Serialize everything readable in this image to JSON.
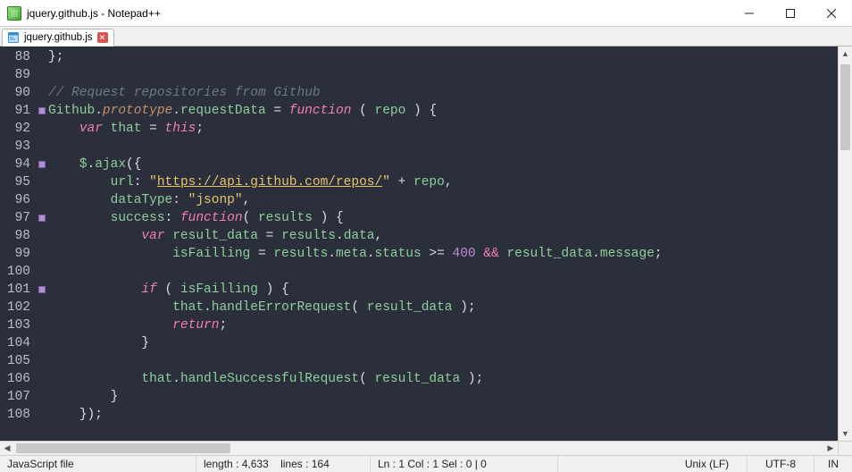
{
  "window": {
    "title": "jquery.github.js - Notepad++"
  },
  "tab": {
    "label": "jquery.github.js"
  },
  "gutter": {
    "start": 88,
    "count": 21
  },
  "fold_markers": [
    91,
    94,
    97,
    101
  ],
  "code_lines": [
    {
      "n": 88,
      "html": "<span class='c-punct'>};</span>"
    },
    {
      "n": 89,
      "html": ""
    },
    {
      "n": 90,
      "html": "<span class='c-comment'>// Request repositories from Github</span>"
    },
    {
      "n": 91,
      "html": "<span class='c-ident'>Github</span><span class='c-dot'>.</span><span class='c-func'>prototype</span><span class='c-dot'>.</span><span class='c-ident'>requestData</span> <span class='c-op'>=</span> <span class='c-key'>function</span> <span class='c-punct'>(</span> <span class='c-ident'>repo</span> <span class='c-punct'>)</span> <span class='c-punct'>{</span>"
    },
    {
      "n": 92,
      "html": "    <span class='c-key'>var</span> <span class='c-ident'>that</span> <span class='c-op'>=</span> <span class='c-key'>this</span><span class='c-punct'>;</span>"
    },
    {
      "n": 93,
      "html": ""
    },
    {
      "n": 94,
      "html": "    <span class='c-ident'>$</span><span class='c-dot'>.</span><span class='c-ident'>ajax</span><span class='c-punct'>({</span>"
    },
    {
      "n": 95,
      "html": "        <span class='c-ident'>url</span><span class='c-punct'>:</span> <span class='c-string'>&quot;</span><span class='c-url'>https://api.github.com/repos/</span><span class='c-string'>&quot;</span> <span class='c-op'>+</span> <span class='c-ident'>repo</span><span class='c-punct'>,</span>"
    },
    {
      "n": 96,
      "html": "        <span class='c-ident'>dataType</span><span class='c-punct'>:</span> <span class='c-string'>&quot;jsonp&quot;</span><span class='c-punct'>,</span>"
    },
    {
      "n": 97,
      "html": "        <span class='c-ident'>success</span><span class='c-punct'>:</span> <span class='c-key'>function</span><span class='c-punct'>(</span> <span class='c-ident'>results</span> <span class='c-punct'>)</span> <span class='c-punct'>{</span>"
    },
    {
      "n": 98,
      "html": "            <span class='c-key'>var</span> <span class='c-ident'>result_data</span> <span class='c-op'>=</span> <span class='c-ident'>results</span><span class='c-dot'>.</span><span class='c-ident'>data</span><span class='c-punct'>,</span>"
    },
    {
      "n": 99,
      "html": "                <span class='c-ident'>isFailling</span> <span class='c-op'>=</span> <span class='c-ident'>results</span><span class='c-dot'>.</span><span class='c-ident'>meta</span><span class='c-dot'>.</span><span class='c-ident'>status</span> <span class='c-op'>&gt;=</span> <span class='c-num'>400</span> <span class='c-keynorm'>&amp;&amp;</span> <span class='c-ident'>result_data</span><span class='c-dot'>.</span><span class='c-ident'>message</span><span class='c-punct'>;</span>"
    },
    {
      "n": 100,
      "html": ""
    },
    {
      "n": 101,
      "html": "            <span class='c-key'>if</span> <span class='c-punct'>(</span> <span class='c-ident'>isFailling</span> <span class='c-punct'>)</span> <span class='c-punct'>{</span>"
    },
    {
      "n": 102,
      "html": "                <span class='c-ident'>that</span><span class='c-dot'>.</span><span class='c-ident'>handleErrorRequest</span><span class='c-punct'>(</span> <span class='c-ident'>result_data</span> <span class='c-punct'>);</span>"
    },
    {
      "n": 103,
      "html": "                <span class='c-key'>return</span><span class='c-punct'>;</span>"
    },
    {
      "n": 104,
      "html": "            <span class='c-punct'>}</span>"
    },
    {
      "n": 105,
      "html": ""
    },
    {
      "n": 106,
      "html": "            <span class='c-ident'>that</span><span class='c-dot'>.</span><span class='c-ident'>handleSuccessfulRequest</span><span class='c-punct'>(</span> <span class='c-ident'>result_data</span> <span class='c-punct'>);</span>"
    },
    {
      "n": 107,
      "html": "        <span class='c-punct'>}</span>"
    },
    {
      "n": 108,
      "html": "    <span class='c-punct'>});</span>"
    }
  ],
  "status": {
    "lang": "JavaScript file",
    "length_label": "length : 4,633",
    "lines_label": "lines : 164",
    "pos": "Ln : 1    Col : 1    Sel : 0 | 0",
    "eol": "Unix (LF)",
    "enc": "UTF-8",
    "ins": "IN"
  }
}
